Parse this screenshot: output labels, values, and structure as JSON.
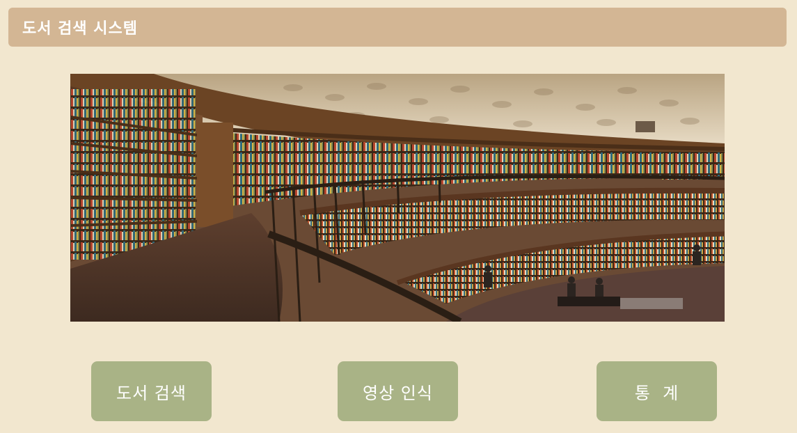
{
  "header": {
    "title": "도서 검색 시스템"
  },
  "banner": {
    "alt": "library-bookshelves-image"
  },
  "buttons": {
    "search_label": "도서 검색",
    "vision_label": "영상 인식",
    "stats_label": "통  계"
  },
  "colors": {
    "background": "#f2e7cf",
    "header": "#d3b694",
    "button": "#a9b386",
    "text_on_color": "#ffffff"
  }
}
